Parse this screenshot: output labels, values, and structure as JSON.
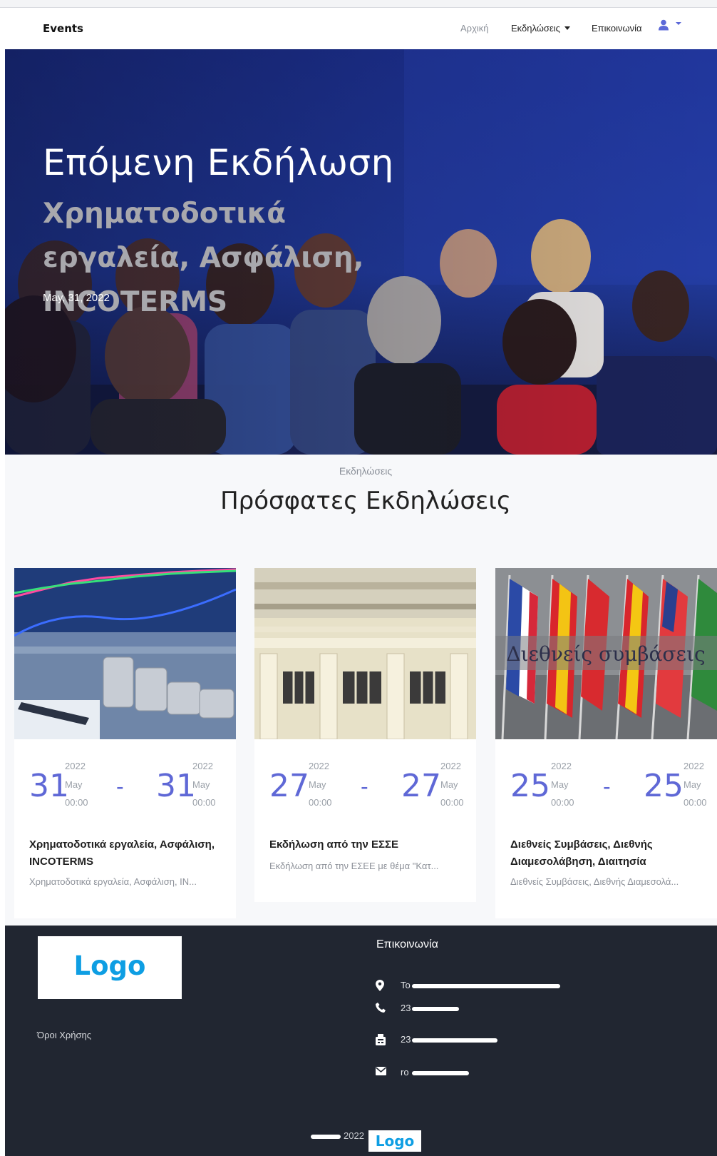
{
  "nav": {
    "brand": "Events",
    "home": "Αρχική",
    "events": "Εκδηλώσεις",
    "contact": "Επικοινωνία",
    "user_icon": "user-icon"
  },
  "hero": {
    "title": "Επόμενη Εκδήλωση",
    "subtitle": "Χρηματοδοτικά εργαλεία, Ασφάλιση, INCOTERMS",
    "date": "May, 31, 2022"
  },
  "section": {
    "kicker": "Εκδηλώσεις",
    "title": "Πρόσφατες Εκδηλώσεις"
  },
  "cards": [
    {
      "start": {
        "day": "31",
        "year": "2022",
        "month": "May",
        "time": "00:00"
      },
      "end": {
        "day": "31",
        "year": "2022",
        "month": "May",
        "time": "00:00"
      },
      "separator": "-",
      "title": "Χρηματοδοτικά εργαλεία, Ασφάλιση, INCOTERMS",
      "description": "Χρηματοδοτικά εργαλεία, Ασφάλιση, IN..."
    },
    {
      "start": {
        "day": "27",
        "year": "2022",
        "month": "May",
        "time": "00:00"
      },
      "end": {
        "day": "27",
        "year": "2022",
        "month": "May",
        "time": "00:00"
      },
      "separator": "-",
      "title": "Εκδήλωση από την ΕΣΣΕ",
      "description": "Εκδήλωση από την ΕΣΕΕ με θέμα \"Κατ..."
    },
    {
      "start": {
        "day": "25",
        "year": "2022",
        "month": "May",
        "time": "00:00"
      },
      "end": {
        "day": "25",
        "year": "2022",
        "month": "May",
        "time": "00:00"
      },
      "separator": "-",
      "title": "Διεθνείς Συμβάσεις, Διεθνής Διαμεσολάβηση, Διαιτησία",
      "description": "Διεθνείς Συμβάσεις, Διεθνής Διαμεσολά...",
      "image_caption": "Διεθνείς συμβάσεις"
    }
  ],
  "footer": {
    "logo": "Logo",
    "terms": "Όροι Χρήσης",
    "contact_title": "Επικοινωνία",
    "address_visible": "Το",
    "phone_visible": "23",
    "fax_visible": "23",
    "email_visible": "ro",
    "copyright_year": "2022",
    "logo_small": "Logo"
  },
  "colors": {
    "accent": "#5f68d6",
    "footer_bg": "#212631",
    "logo_blue": "#0e9ee3"
  }
}
